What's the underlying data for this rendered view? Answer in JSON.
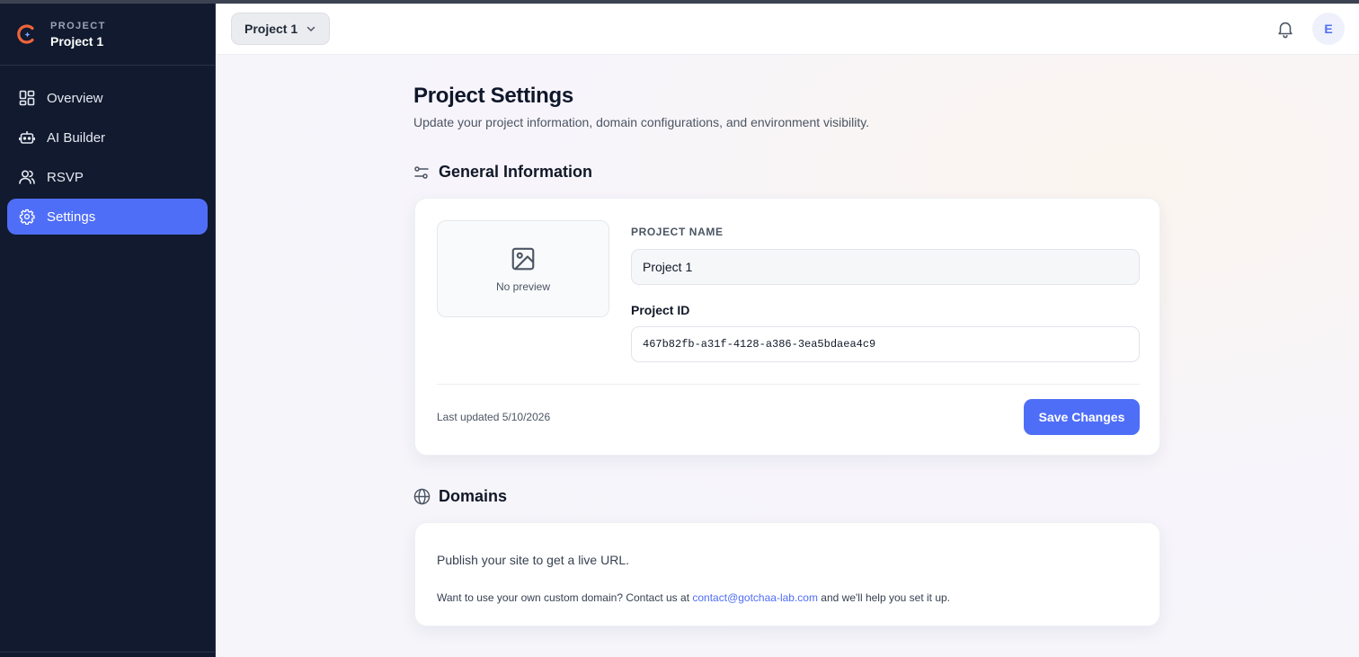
{
  "sidebar": {
    "brand_small": "PROJECT",
    "brand_name": "Project 1",
    "items": [
      {
        "label": "Overview",
        "icon": "grid-icon"
      },
      {
        "label": "AI Builder",
        "icon": "robot-icon"
      },
      {
        "label": "RSVP",
        "icon": "users-icon"
      },
      {
        "label": "Settings",
        "icon": "gear-icon",
        "active": true
      }
    ]
  },
  "topbar": {
    "project_select": "Project 1",
    "avatar_initial": "E"
  },
  "page": {
    "title": "Project Settings",
    "subtitle": "Update your project information, domain configurations, and environment visibility."
  },
  "general": {
    "heading": "General Information",
    "preview_text": "No preview",
    "name_label": "PROJECT NAME",
    "name_value": "Project 1",
    "id_label": "Project ID",
    "id_value": "467b82fb-a31f-4128-a386-3ea5bdaea4c9",
    "last_updated": "Last updated 5/10/2026",
    "save_label": "Save Changes"
  },
  "domains": {
    "heading": "Domains",
    "publish_text": "Publish your site to get a live URL.",
    "custom_prefix": "Want to use your own custom domain? Contact us at ",
    "contact_email": "contact@gotchaa-lab.com",
    "custom_suffix": " and we'll help you set it up."
  },
  "colors": {
    "accent": "#4f6ef7",
    "sidebar_bg": "#111a2e",
    "brand_orange": "#f0643c"
  }
}
